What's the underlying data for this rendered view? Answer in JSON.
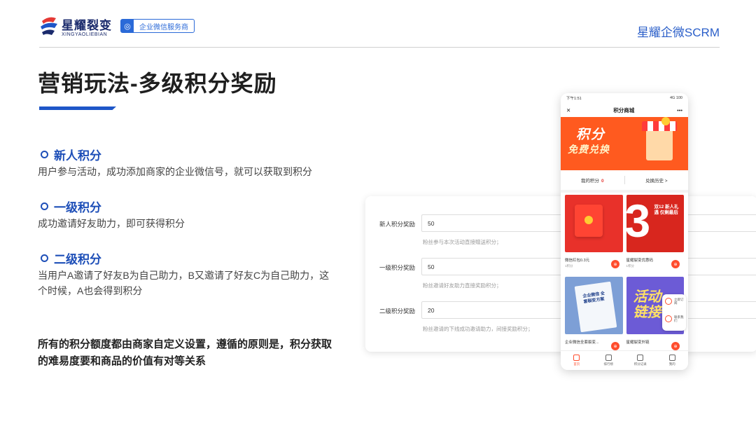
{
  "header": {
    "logo_cn": "星耀裂变",
    "logo_en": "XINGYAOLIEBIAN",
    "badge": "企业微信服务商",
    "brand": "星耀企微SCRM"
  },
  "title": "营销玩法-多级积分奖励",
  "sections": [
    {
      "heading": "新人积分",
      "desc": "用户参与活动，成功添加商家的企业微信号，就可以获取到积分"
    },
    {
      "heading": "一级积分",
      "desc": "成功邀请好友助力，即可获得积分"
    },
    {
      "heading": "二级积分",
      "desc": "当用户A邀请了好友B为自己助力，B又邀请了好友C为自己助力，这个时候，A也会得到积分"
    }
  ],
  "summary": "所有的积分额度都由商家自定义设置，遵循的原则是，积分获取的难易度要和商品的价值有对等关系",
  "form": {
    "rows": [
      {
        "label": "新人积分奖励",
        "value": "50",
        "hint": "粉丝参与本次活动直接赠送积分；"
      },
      {
        "label": "一级积分奖励",
        "value": "50",
        "hint": "粉丝邀请好友助力直接奖励积分；"
      },
      {
        "label": "二级积分奖励",
        "value": "20",
        "hint": "粉丝邀请的下线成功邀请助力，间接奖励积分；"
      }
    ]
  },
  "phone": {
    "status_time": "下午1:51",
    "status_right": "4G 100",
    "nav_close": "✕",
    "nav_title": "积分商城",
    "nav_more": "•••",
    "banner_line1": "积分",
    "banner_line2": "免费兑换",
    "my_points_label": "我的积分",
    "my_points_value": "0",
    "history_label": "兑换历史 >",
    "items": [
      {
        "name": "微信红包0.3元",
        "sub": "1积分"
      },
      {
        "name": "星耀裂变优惠码",
        "sub": "1积分"
      },
      {
        "name": "企业微信全套裂变...",
        "sub": ""
      },
      {
        "name": "星耀裂变外链",
        "sub": ""
      }
    ],
    "promo_text": "双12 新人礼遇 仅剩最后",
    "promo_big": "3",
    "book_text": "企业微信 全套裂变方案",
    "act_text": "活动 链接",
    "side_btn1": "立即订阅",
    "side_btn2": "联系我们",
    "tabs": [
      "首页",
      "排行榜",
      "积分记录",
      "我的"
    ]
  },
  "colors": {
    "accent": "#1e56c8",
    "phone_accent": "#ff4d2d"
  }
}
